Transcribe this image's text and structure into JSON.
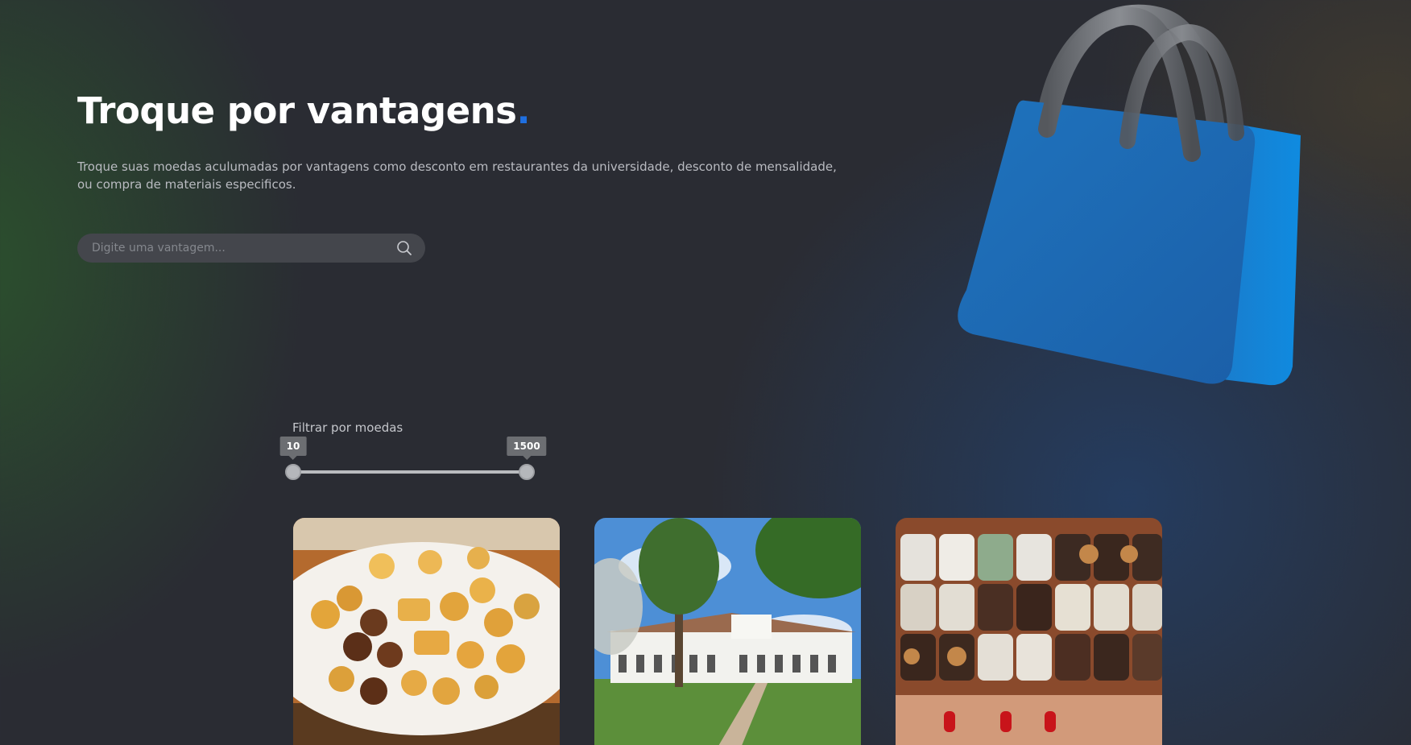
{
  "hero": {
    "title": "Troque por vantagens",
    "title_dot": ".",
    "description": "Troque suas moedas aculumadas por vantagens como desconto em restaurantes da universidade, desconto de mensalidade, ou compra de materiais especificos."
  },
  "search": {
    "placeholder": "Digite uma vantagem...",
    "value": "",
    "icon": "search-icon"
  },
  "filter": {
    "label": "Filtrar por moedas",
    "min_label": "10",
    "max_label": "1500",
    "min_value": 10,
    "max_value": 1500,
    "range_min": 10,
    "range_max": 1500
  },
  "cards": [
    {
      "image": "savory-snacks-platter"
    },
    {
      "image": "university-campus-building"
    },
    {
      "image": "chocolate-truffles-box"
    }
  ],
  "colors": {
    "background": "#2a2c33",
    "accent": "#1f6fe0",
    "bag_blue": "#1a78c9"
  }
}
